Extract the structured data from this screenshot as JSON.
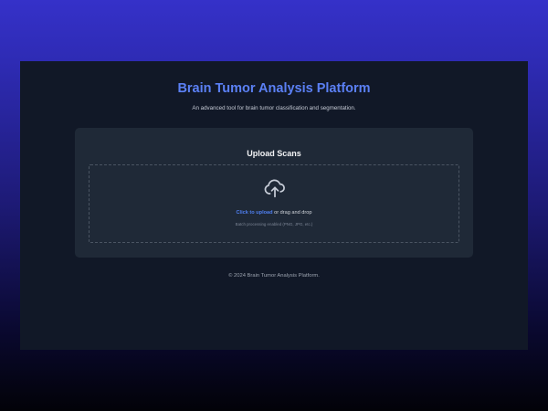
{
  "header": {
    "title": "Brain Tumor Analysis Platform",
    "subtitle": "An advanced tool for brain tumor classification and segmentation."
  },
  "upload": {
    "title": "Upload Scans",
    "icon": "cloud-upload-icon",
    "link_label": "Click to upload",
    "rest_label": " or drag and drop",
    "hint": "Batch processing enabled (PNG, JPG, etc.)"
  },
  "footer": {
    "text": "© 2024 Brain Tumor Analysis Platform."
  },
  "colors": {
    "accent": "#5b80f5",
    "link": "#4f7ff0",
    "panel": "#111827",
    "card": "#1f2937"
  }
}
